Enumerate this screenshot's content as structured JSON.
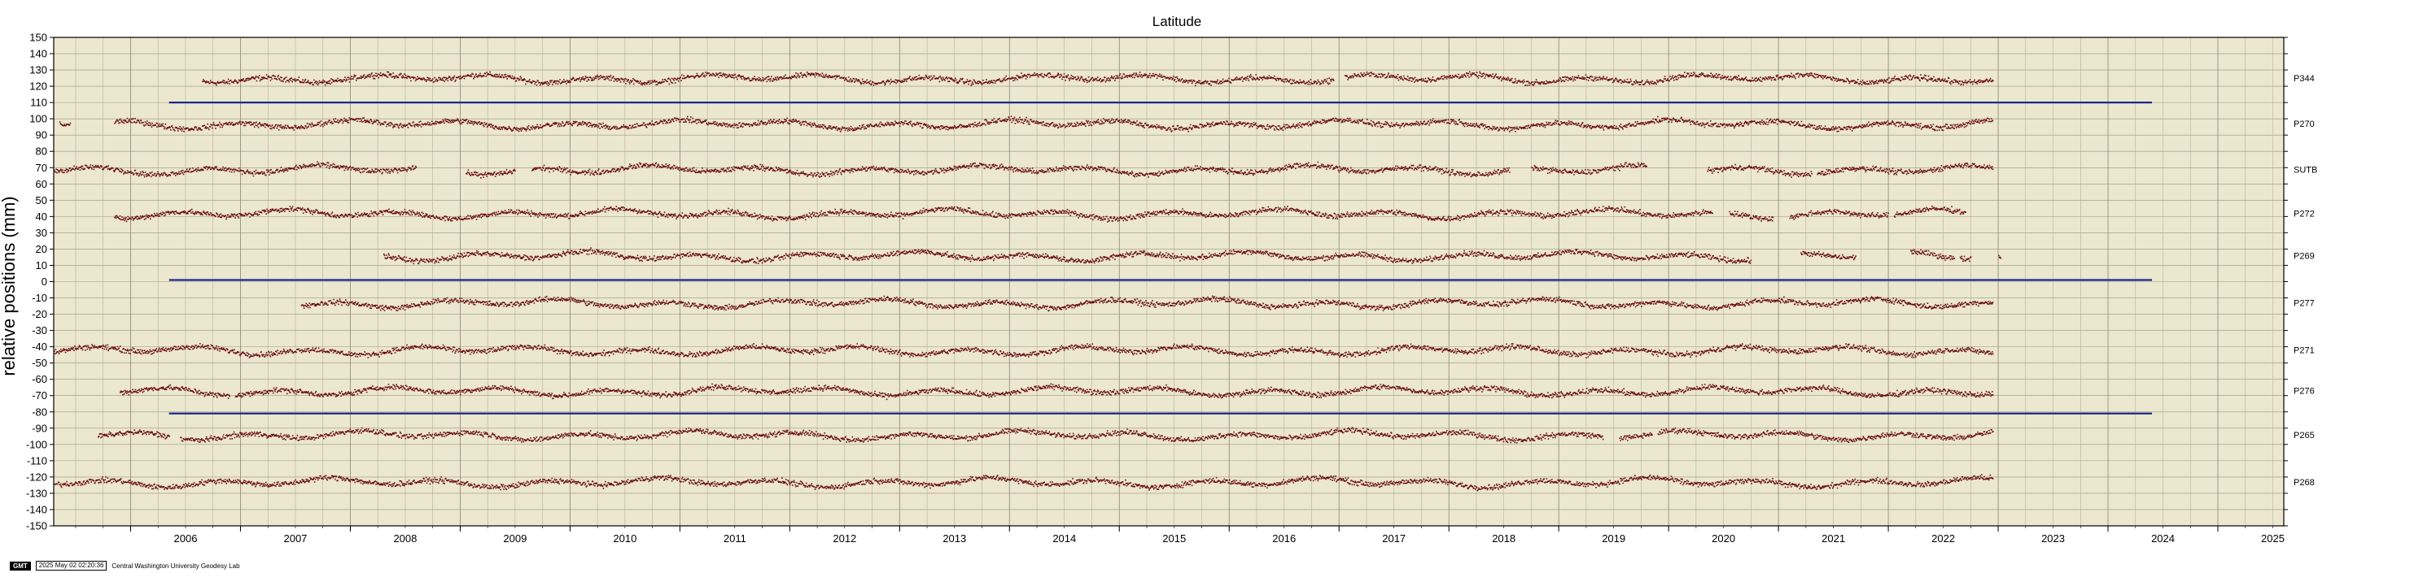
{
  "chart_data": {
    "type": "scatter",
    "title": "Latitude",
    "xlabel": "",
    "ylabel": "relative positions (mm)",
    "xlim": [
      2005.3,
      2025.6
    ],
    "ylim": [
      -150,
      150
    ],
    "x_ticks": [
      2006,
      2007,
      2008,
      2009,
      2010,
      2011,
      2012,
      2013,
      2014,
      2015,
      2016,
      2017,
      2018,
      2019,
      2020,
      2021,
      2022,
      2023,
      2024,
      2025
    ],
    "y_ticks": [
      -150,
      -140,
      -130,
      -120,
      -110,
      -100,
      -90,
      -80,
      -70,
      -60,
      -50,
      -40,
      -30,
      -20,
      -10,
      0,
      10,
      20,
      30,
      40,
      50,
      60,
      70,
      80,
      90,
      100,
      110,
      120,
      130,
      140,
      150
    ],
    "grid": true,
    "background_color": "#ece7cf",
    "point_color": "#6b0f14",
    "separator_color": "#1a2a8a",
    "separators": [
      {
        "y": 110,
        "x_start": 2006.35,
        "x_end": 2024.4
      },
      {
        "y": 1,
        "x_start": 2006.35,
        "x_end": 2024.4
      },
      {
        "y": -81,
        "x_start": 2006.35,
        "x_end": 2024.4
      }
    ],
    "series": [
      {
        "name": "P344",
        "offset": 125,
        "segments": [
          [
            2006.65,
            2016.95
          ],
          [
            2017.05,
            2022.95
          ]
        ]
      },
      {
        "name": "P270",
        "offset": 97,
        "segments": [
          [
            2005.35,
            2005.45
          ],
          [
            2005.85,
            2022.95
          ]
        ]
      },
      {
        "name": "SUTB",
        "offset": 69,
        "segments": [
          [
            2005.3,
            2008.6
          ],
          [
            2009.05,
            2009.5
          ],
          [
            2009.65,
            2018.55
          ],
          [
            2018.75,
            2019.8
          ],
          [
            2020.35,
            2021.3
          ],
          [
            2021.35,
            2022.95
          ]
        ]
      },
      {
        "name": "P272",
        "offset": 42,
        "segments": [
          [
            2005.85,
            2020.4
          ],
          [
            2020.55,
            2020.95
          ],
          [
            2021.1,
            2022.0
          ],
          [
            2022.05,
            2022.7
          ]
        ]
      },
      {
        "name": "P269",
        "offset": 16,
        "segments": [
          [
            2008.3,
            2020.75
          ],
          [
            2021.2,
            2021.7
          ],
          [
            2022.2,
            2022.6
          ],
          [
            2022.65,
            2022.75
          ],
          [
            2023.0,
            2023.02
          ]
        ]
      },
      {
        "name": "P277",
        "offset": -13,
        "segments": [
          [
            2007.55,
            2022.95
          ]
        ]
      },
      {
        "name": "P271",
        "offset": -42,
        "segments": [
          [
            2005.3,
            2022.95
          ]
        ]
      },
      {
        "name": "P276",
        "offset": -67,
        "segments": [
          [
            2005.9,
            2006.9
          ],
          [
            2006.95,
            2022.95
          ]
        ]
      },
      {
        "name": "P265",
        "offset": -94,
        "segments": [
          [
            2005.7,
            2006.35
          ],
          [
            2006.45,
            2019.4
          ],
          [
            2019.55,
            2019.85
          ],
          [
            2019.9,
            2022.95
          ]
        ]
      },
      {
        "name": "P268",
        "offset": -123,
        "segments": [
          [
            2005.3,
            2022.95
          ]
        ]
      }
    ]
  },
  "footer": {
    "logo_text": "GMT",
    "timestamp": "2025 May 02 02:20:36",
    "org": "Central Washington University Geodesy Lab"
  }
}
